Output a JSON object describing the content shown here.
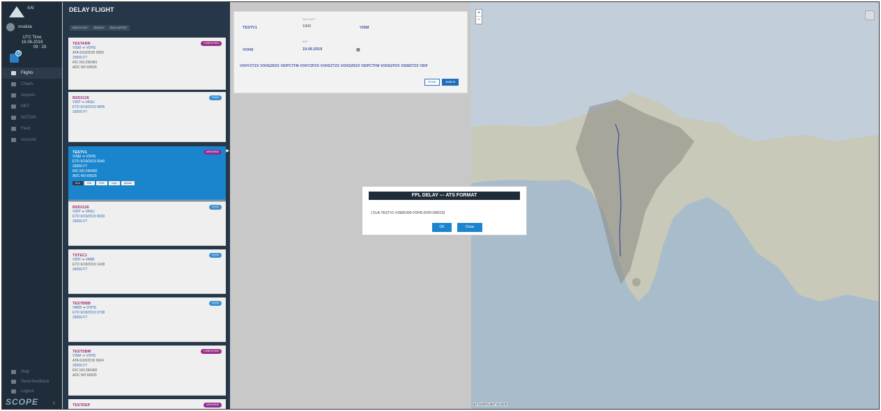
{
  "sidebar": {
    "logo_text": "AAI",
    "user": "nrudula",
    "utc_label": "UTC Time",
    "utc_date": "19-06-2019",
    "utc_time": "09 : 28",
    "notification_count": "3",
    "nav": [
      {
        "label": "Flights",
        "icon": "plane-icon",
        "active": true
      },
      {
        "label": "Charts",
        "icon": "chart-icon"
      },
      {
        "label": "Airports",
        "icon": "airport-icon"
      },
      {
        "label": "MET",
        "icon": "cloud-icon"
      },
      {
        "label": "NOTAM",
        "icon": "warning-icon"
      },
      {
        "label": "Fleet",
        "icon": "fleet-icon"
      },
      {
        "label": "Account",
        "icon": "gear-icon"
      }
    ],
    "bottom_nav": [
      {
        "label": "Help",
        "icon": "help-icon"
      },
      {
        "label": "Send-feedback",
        "icon": "feedback-icon"
      },
      {
        "label": "Logout",
        "icon": "logout-icon"
      }
    ],
    "brand": "SCOPE"
  },
  "panel": {
    "title": "DELAY FLIGHT",
    "buttons": [
      "NEW FLIGHT",
      "SEARCH",
      "BULK IMPORT"
    ],
    "flights": [
      {
        "id": "TESTARR",
        "status": "COMPLETED",
        "route": "VISM ➔ VOHS",
        "time": "ATA 6/19/2019 0900",
        "level": "33000 FT",
        "ric": "RIC NO:290481",
        "adc": "ADC NO:60634"
      },
      {
        "id": "BSD2126",
        "status": "FILED",
        "route": "VIDP ➔ VASU",
        "time": "ETD 6/19/2019 0845",
        "level": "33000 FT"
      },
      {
        "id": "TESTV1",
        "status": "AIRBORNE",
        "route": "VISM ➔ VOHS",
        "time": "ETD 6/19/2019 0540",
        "level": "33000 FT",
        "ric": "RIC NO:290482",
        "adc": "ADC NO:60635",
        "actions": [
          "DLA",
          "CNL",
          "CHG",
          "Copy",
          "Upload"
        ]
      },
      {
        "id": "BSD2126",
        "status": "FILED",
        "route": "VIDP ➔ VASU",
        "time": "ETD 6/19/2019 0630",
        "level": "33000 FT"
      },
      {
        "id": "TSTEC1",
        "status": "FILED",
        "route": "VIDP ➔ VABB",
        "time": "ETD 6/18/2019 1438",
        "level": "34000 FT"
      },
      {
        "id": "TESTBBB",
        "status": "FILED",
        "route": "VABB ➔ VOHS",
        "time": "ETD 6/18/2019 0738",
        "level": "33000 FT"
      },
      {
        "id": "TESTSBM",
        "status": "COMPLETED",
        "route": "VISM ➔ VOHS",
        "time": "ATA 6/18/2019 0604",
        "level": "33000 FT",
        "ric": "RIC NO:290482",
        "adc": "ADC NO:60635"
      },
      {
        "id": "TESTDEP",
        "status": "AIRBORNE"
      }
    ]
  },
  "form": {
    "callsign": "TESTV1",
    "eobt_label": "New EOBT *",
    "eobt_value": "1000",
    "dep": "VISM",
    "arr": "VOHS",
    "dof_label": "DOF",
    "dof_value": "19-06-2019",
    "route": "VOHYZTZX VOHSZRZX VIDPCTFM VOHYZPZX VOHSZTZX VOHSZRZX VIDPCTFM VOHSZPZX VISMZTZX VIDF",
    "close_label": "Close",
    "submit_label": "Submit"
  },
  "map": {
    "zoom_in": "+",
    "zoom_out": "−",
    "coords": "44°13'33\"N 057°31'45\"E"
  },
  "modal": {
    "title": "FPL DELAY --- ATS FORMAT",
    "message": "( DLA-TESTV1-VISM1000-VOHS-DOF/190619)",
    "ok_label": "OK",
    "close_label": "Close"
  },
  "colors": {
    "sidebar_bg": "#1f2d3a",
    "accent": "#1a85cc",
    "completed": "#9b2f8a",
    "filed": "#3b8fd1"
  }
}
